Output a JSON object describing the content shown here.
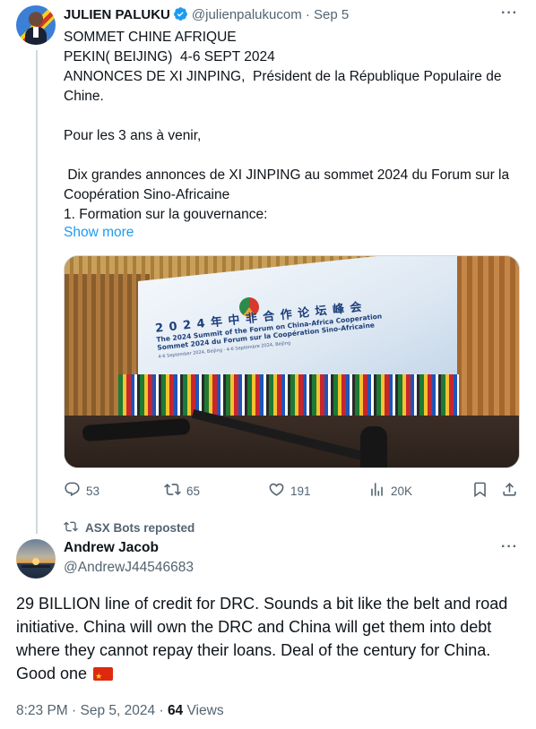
{
  "tweet1": {
    "author_name": "JULIEN PALUKU",
    "handle": "@julienpalukucom",
    "separator": "·",
    "date": "Sep 5",
    "lines": [
      "SOMMET CHINE AFRIQUE",
      "PEKIN( BEIJING)  4-6 SEPT 2024",
      "ANNONCES DE XI JINPING,  Président de la République Populaire de Chine.",
      "Pour les 3 ans à venir,",
      " Dix grandes annonces de XI JINPING au sommet 2024 du Forum sur la Coopération Sino-Africaine",
      "1. Formation sur la gouvernance:"
    ],
    "show_more": "Show more",
    "media": {
      "screen_title_cn": "2 0 2 4 年 中 非 合 作 论 坛 峰 会",
      "screen_title_en": "The 2024 Summit of the Forum on China-Africa Cooperation",
      "screen_title_fr": "Sommet 2024 du Forum sur la Coopération Sino-Africaine",
      "screen_date": "4-6 September 2024, Beijing · 4-6 Septembre 2024, Beijing"
    },
    "actions": {
      "replies": "53",
      "reposts": "65",
      "likes": "191",
      "views": "20K"
    }
  },
  "repost_banner": "ASX Bots reposted",
  "tweet2": {
    "author_name": "Andrew Jacob",
    "handle": "@AndrewJ44546683",
    "text": "29 BILLION line of credit for DRC. Sounds a bit like the belt and road initiative. China will own the DRC and China will get them into debt where they cannot repay their loans. Deal of the century for China. Good one",
    "time": "8:23 PM",
    "separator": "·",
    "date": "Sep 5, 2024",
    "views_count": "64",
    "views_label": "Views"
  },
  "icons": [
    "more-icon",
    "verified-icon",
    "reply-icon",
    "repost-icon",
    "like-icon",
    "views-icon",
    "bookmark-icon",
    "share-icon",
    "china-flag-emoji"
  ],
  "colors": {
    "accent": "#1d9bf0",
    "secondary_text": "#536471",
    "divider": "#cfd9de"
  }
}
